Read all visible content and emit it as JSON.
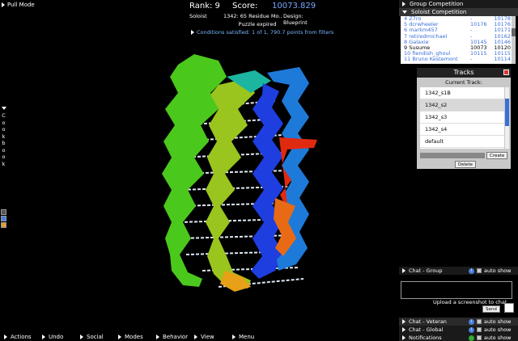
{
  "top_left": {
    "pull_mode": "Pull Mode"
  },
  "score_panel": {
    "rank": "Rank: 9",
    "score_label": "Score:",
    "score_value": "10073.829",
    "mode": "Soloist",
    "puzzle": "1342: 65 Residue Mo...",
    "design": "Design: Blueprint",
    "status": "Puzzle expired",
    "conditions": "Conditions satisfied: 1 of 1, 790.7 points from filters"
  },
  "cookbook": {
    "label": "Cookbook",
    "letters": [
      "C",
      "o",
      "o",
      "k",
      "b",
      "o",
      "o",
      "k"
    ]
  },
  "competition": {
    "group_label": "Group Competition",
    "soloist_label": "Soloist Competition",
    "rows": [
      {
        "name": "4 Z7ro",
        "s1": "-",
        "s2": "10178"
      },
      {
        "name": "5 dcrwheeler",
        "s1": "10176",
        "s2": "10176"
      },
      {
        "name": "6 markm457",
        "s1": "-",
        "s2": "10171"
      },
      {
        "name": "7 retiredmichael",
        "s1": "-",
        "s2": "10162"
      },
      {
        "name": "8 Galaxie",
        "s1": "10145",
        "s2": "10146"
      },
      {
        "name": "9 Susume",
        "s1": "10073",
        "s2": "10120"
      },
      {
        "name": "10 fiendish_ghoul",
        "s1": "10115",
        "s2": "10115"
      },
      {
        "name": "11 Bruno Kestemont",
        "s1": "-",
        "s2": "10114"
      }
    ]
  },
  "tracks": {
    "title": "Tracks",
    "current_label": "Current Track:",
    "items": [
      "1342_s1B",
      "1342_s2",
      "1342_s3",
      "1342_s4",
      "default"
    ],
    "create": "Create",
    "delete": "Delete"
  },
  "chat": {
    "group": "Chat - Group",
    "upload": "Upload a screenshot to chat.",
    "send": "Send",
    "veteran": "Chat - Veteran",
    "global": "Chat - Global",
    "notifications": "Notifications",
    "auto_show": "auto show",
    "info": "i"
  },
  "bottom_bar": [
    "Actions",
    "Undo",
    "Social",
    "Modes",
    "Behavior",
    "View",
    "Menu"
  ],
  "colors": {
    "score_blue": "#7aa8ff",
    "link_blue": "#3a6fd8",
    "highlight_red": "#d33"
  }
}
